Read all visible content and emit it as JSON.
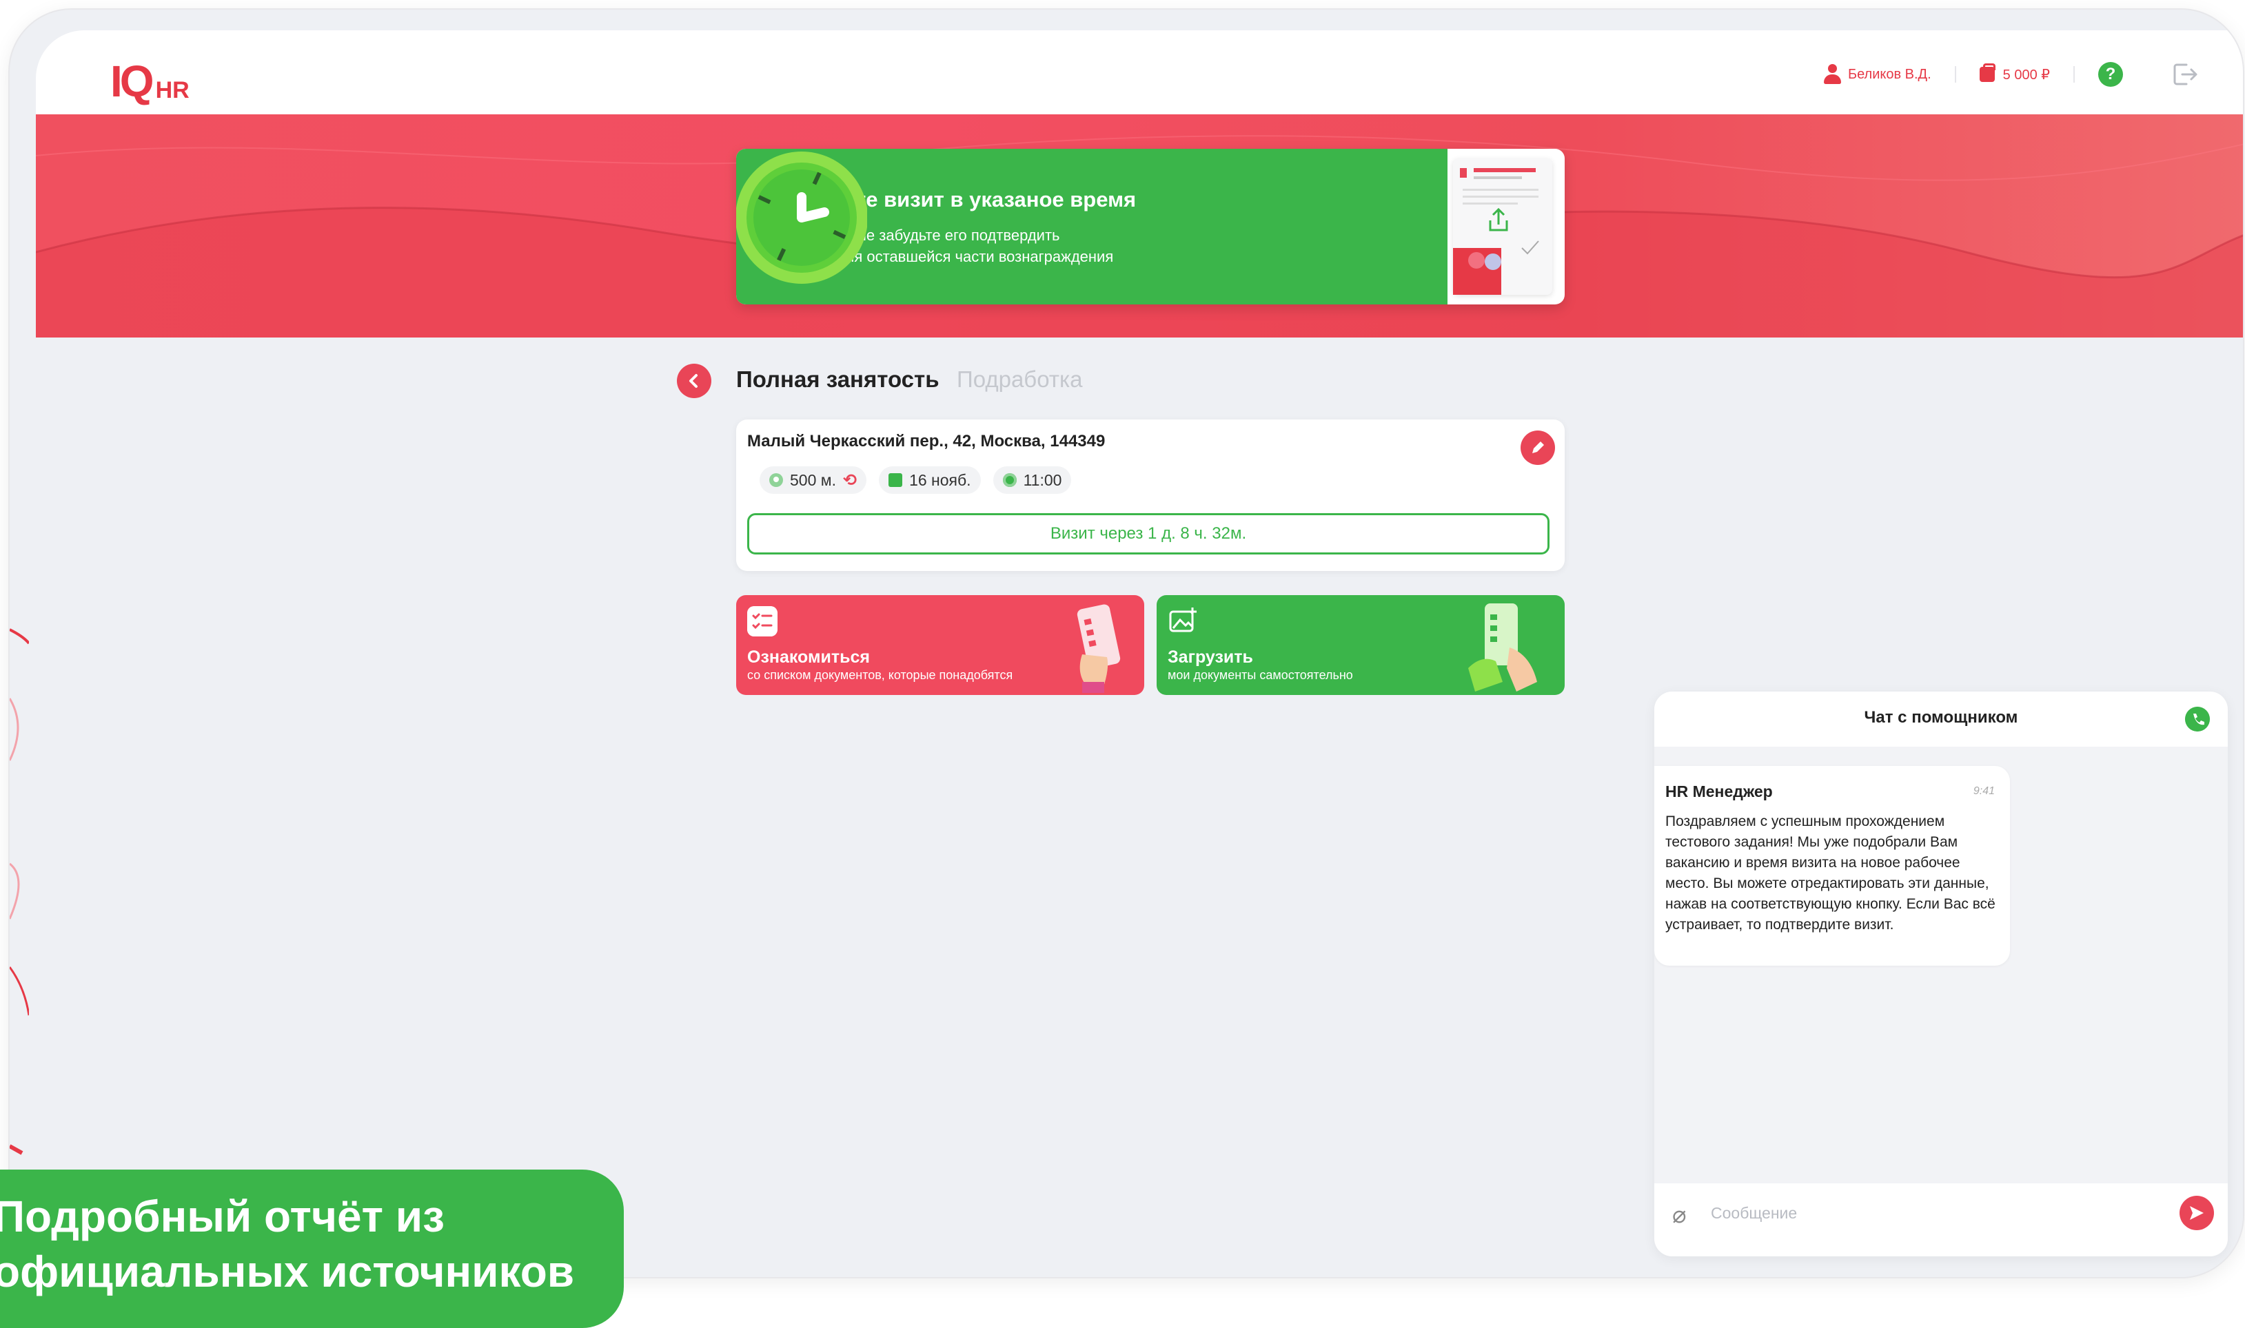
{
  "header": {
    "logo_main": "IQ",
    "logo_suffix": "HR",
    "user_name": "Беликов В.Д.",
    "balance": "5 000 ₽",
    "help_label": "?"
  },
  "banner": {
    "title": "Совершите визит в указаное время",
    "subtitle_line1": "После визита не забудьте его подтвердить",
    "subtitle_line2": "для получения оставшейся части вознаграждения"
  },
  "tabs": {
    "active": "Полная занятость",
    "inactive": "Подработка"
  },
  "visit": {
    "address": "Малый Черкасский пер., 42, Москва, 144349",
    "distance": "500 м.",
    "date": "16 нояб.",
    "time": "11:00",
    "countdown": "Визит через 1 д. 8 ч. 32м."
  },
  "actions": {
    "review_title": "Ознакомиться",
    "review_subtitle": "со списком документов, которые понадобятся",
    "upload_title": "Загрузить",
    "upload_subtitle": "мои документы самостоятельно"
  },
  "chat": {
    "title": "Чат с помощником",
    "message": {
      "sender": "HR Менеджер",
      "time": "9:41",
      "text": "Поздравляем с успешным прохождением тестового задания! Мы уже подобрали Вам вакансию и время визита на новое рабочее место. Вы можете отредактировать эти данные, нажав на соответствующую кнопку. Если Вас всё устраивает, то подтвердите визит."
    },
    "input_placeholder": "Сообщение"
  },
  "promo": {
    "line1": "Подробный отчёт из",
    "line2": "официальных источников"
  },
  "colors": {
    "brand_red": "#e94557",
    "brand_green": "#3bb54a"
  },
  "icons": [
    "user-icon",
    "wallet-icon",
    "help-icon",
    "logout-icon",
    "back-chevron-icon",
    "edit-pencil-icon",
    "location-pin-icon",
    "refresh-icon",
    "calendar-icon",
    "clock-icon",
    "checklist-icon",
    "image-upload-icon",
    "phone-icon",
    "paperclip-icon",
    "send-icon"
  ]
}
